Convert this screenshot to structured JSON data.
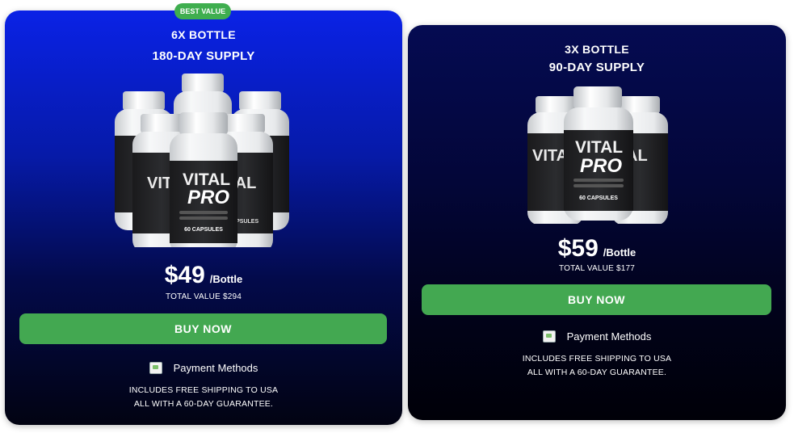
{
  "offers": [
    {
      "badge": "BEST VALUE",
      "title": "6X BOTTLE",
      "supply": "180-DAY SUPPLY",
      "product": {
        "brand_top": "VITAL",
        "brand_bottom": "PRO",
        "capsules": "60 CAPSULES"
      },
      "price": "$49",
      "per": "/Bottle",
      "total": "TOTAL VALUE $294",
      "buy_label": "BUY NOW",
      "payment_alt": "Payment Methods",
      "shipping_line1": "INCLUDES FREE SHIPPING TO USA",
      "shipping_line2": "ALL WITH A 60-DAY GUARANTEE."
    },
    {
      "title": "3X BOTTLE",
      "supply": "90-DAY SUPPLY",
      "product": {
        "brand_top": "VITAL",
        "brand_bottom": "PRO",
        "capsules": "60 CAPSULES"
      },
      "price": "$59",
      "per": "/Bottle",
      "total": "TOTAL VALUE $177",
      "buy_label": "BUY NOW",
      "payment_alt": "Payment Methods",
      "shipping_line1": "INCLUDES FREE SHIPPING TO USA",
      "shipping_line2": "ALL WITH A 60-DAY GUARANTEE."
    }
  ],
  "colors": {
    "card_6x_top": "#0a22e6",
    "card_3x_top": "#050b52",
    "button_green": "#43a851",
    "badge_green": "#3fae4f"
  }
}
